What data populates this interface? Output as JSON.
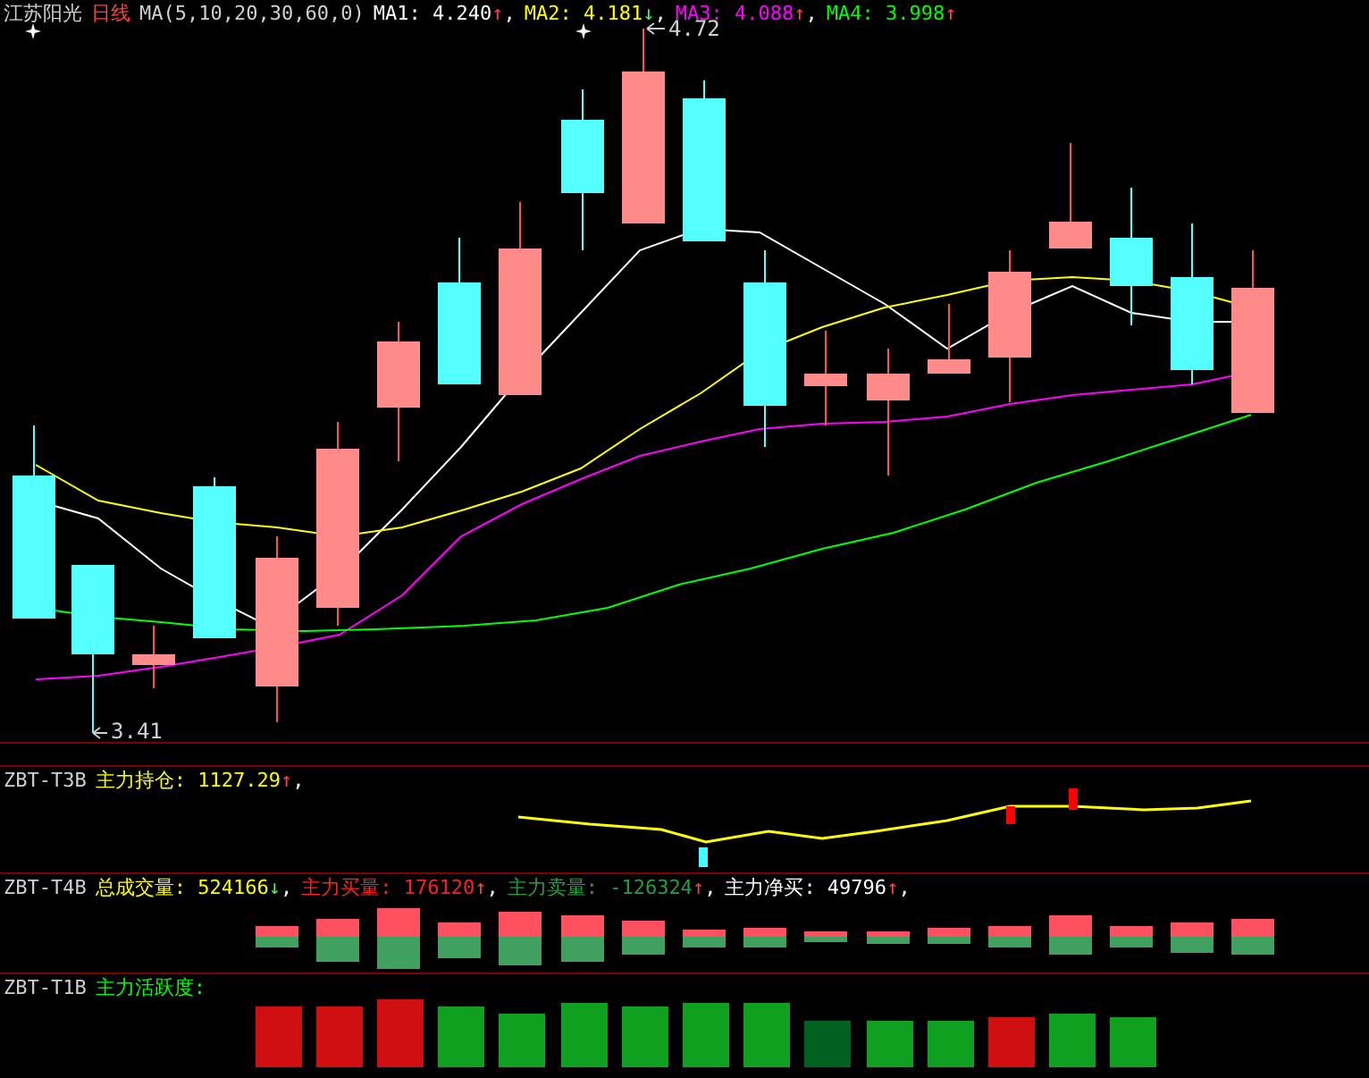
{
  "header": {
    "stock": "江苏阳光",
    "period": "日线",
    "ma_params": "MA(5,10,20,30,60,0)",
    "ma": [
      {
        "label": "MA1:",
        "value": "4.240",
        "arrow": "↑",
        "rising": true,
        "suffix": ",",
        "color": "#ffffff"
      },
      {
        "label": "MA2:",
        "value": "4.181",
        "arrow": "↓",
        "rising": false,
        "suffix": ",",
        "color": "#ffff00"
      },
      {
        "label": "MA3:",
        "value": "4.088",
        "arrow": "↑",
        "rising": true,
        "suffix": ",",
        "color": "#ff00ff"
      },
      {
        "label": "MA4:",
        "value": "3.998",
        "arrow": "↑",
        "rising": true,
        "color": "#00ff00"
      }
    ]
  },
  "price_labels": {
    "high": "4.72",
    "low": "3.41"
  },
  "panels": [
    {
      "name": "ZBT-T3B",
      "items": [
        {
          "label": "主力持仓:",
          "value": "1127.29",
          "arrow": "↑",
          "rising": true,
          "suffix": ",",
          "color": "#ffff00"
        }
      ]
    },
    {
      "name": "ZBT-T4B",
      "items": [
        {
          "label": "总成交量:",
          "value": "524166",
          "arrow": "↓",
          "rising": false,
          "suffix": ",",
          "color": "#ffff00"
        },
        {
          "label": "主力买量:",
          "value": "176120",
          "arrow": "↑",
          "rising": true,
          "suffix": ",",
          "color": "#ff2020"
        },
        {
          "label": "主力卖量:",
          "value": "-126324",
          "arrow": "↑",
          "rising": true,
          "suffix": ",",
          "color": "#20a040"
        },
        {
          "label": "主力净买:",
          "value": "49796",
          "arrow": "↑",
          "rising": true,
          "suffix": ",",
          "color": "#ffffff"
        }
      ]
    },
    {
      "name": "ZBT-T1B",
      "items": [
        {
          "label": "主力活跃度:",
          "color": "#00ff00"
        }
      ]
    }
  ]
}
